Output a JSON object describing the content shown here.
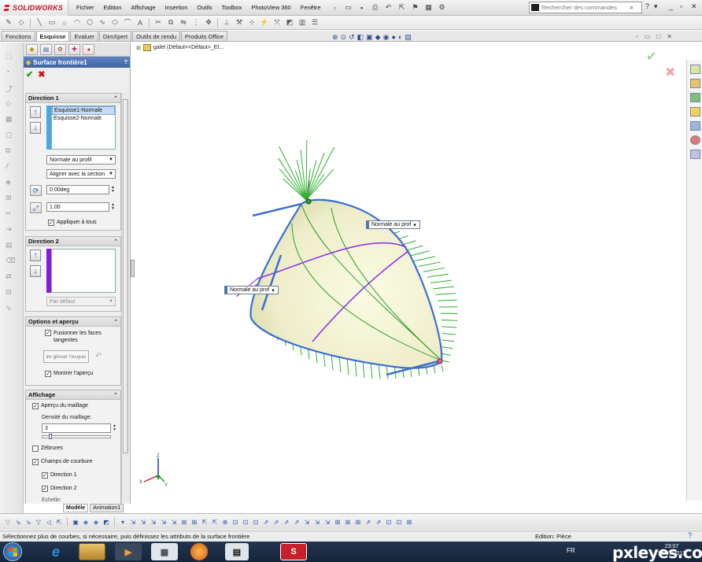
{
  "app": {
    "logo": "SOLIDWORKS",
    "menu": [
      "Fichier",
      "Edition",
      "Affichage",
      "Insertion",
      "Outils",
      "Toolbox",
      "PhotoView 360",
      "Fenêtre"
    ]
  },
  "search": {
    "placeholder": "Rechercher des commandes"
  },
  "command_tabs": [
    "Fonctions",
    "Esquisse",
    "Evaluer",
    "DimXpert",
    "Outils de rendu",
    "Produits Office"
  ],
  "active_command_tab": "Esquisse",
  "property_manager": {
    "title": "Surface frontière1",
    "help": "?",
    "direction1": {
      "header": "Direction 1",
      "curves": [
        "Esquisse1-Normale",
        "Esquisse2-Normale"
      ],
      "tangency": "Normale au profil",
      "alignment": "Aligner avec la section",
      "angle": "0.00deg",
      "length": "1.00",
      "apply_all": "Appliquer à tous"
    },
    "direction2": {
      "header": "Direction 2",
      "tangency": "Par défaut"
    },
    "options": {
      "header": "Options et aperçu",
      "merge": "Fusionner les faces tangentes",
      "drag_sketch": "ire glisser l'esquis",
      "show_preview": "Montrer l'aperçu"
    },
    "display": {
      "header": "Affichage",
      "mesh_preview": "Aperçu du maillage",
      "mesh_density_label": "Densité du maillage:",
      "mesh_density_value": "3",
      "mesh_density_fraction": 0.1,
      "zebra": "Zébrures",
      "curvature": "Champs de courbure",
      "dir1": "Direction 1",
      "dir2": "Direction 2",
      "scale": "Echelle:"
    }
  },
  "feature_tree": {
    "root": "galet  (Défaut<<Défaut>_Et..."
  },
  "callouts": {
    "c1": "Normale au prof",
    "c2": "Normale au prof"
  },
  "bottom_tabs": [
    "Modèle",
    "Animation1"
  ],
  "status": {
    "message": "Sélectionnez plus de courbes, si nécessaire, puis définissez les attributs de la surface frontière",
    "mode": "Edition: Pièce",
    "help": "?"
  },
  "taskbar": {
    "lang": "FR",
    "time": "23:07",
    "date": "24/07/2013",
    "watermark": "pxleyes.com"
  },
  "triad": {
    "x": "X",
    "y": "Y",
    "z": "Z"
  },
  "colors": {
    "accent": "#3d63a6",
    "ok": "#1a9a1a",
    "cancel": "#c81818",
    "surface": "#f0f0c8",
    "comb_purple": "#8a2be2",
    "comb_green": "#2ab02a",
    "edge_blue": "#3a6fd0"
  }
}
